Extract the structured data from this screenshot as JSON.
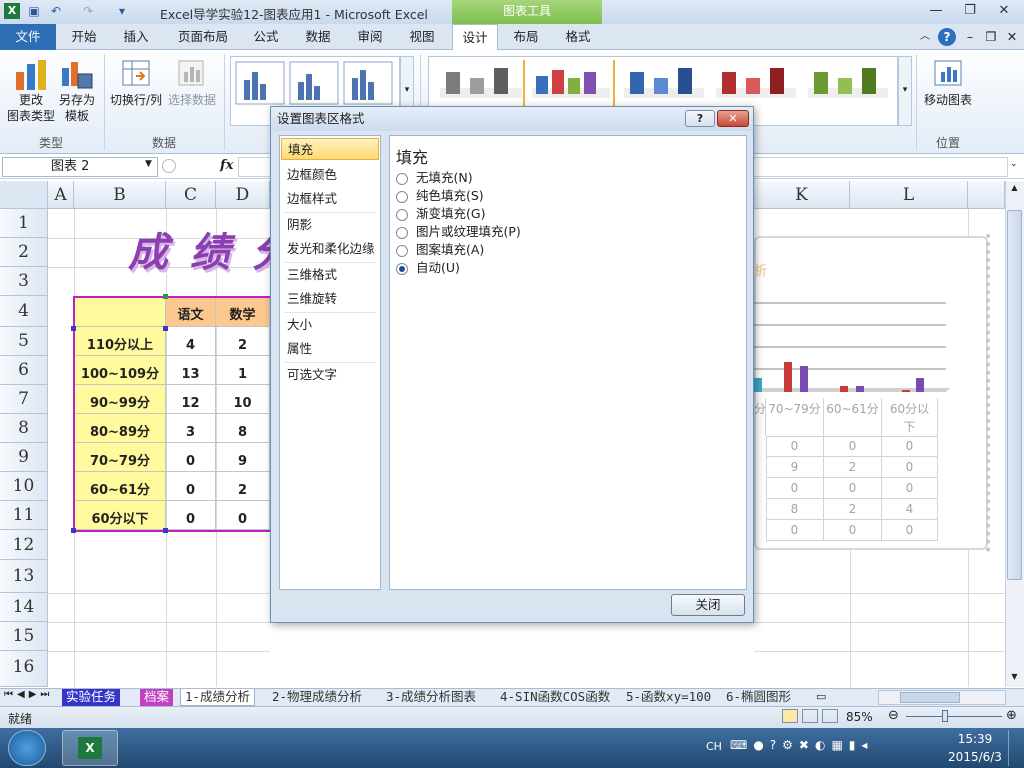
{
  "titlebar": {
    "title": "Excel导学实验12-图表应用1  -  Microsoft Excel",
    "context_tab_group": "图表工具"
  },
  "tabs": [
    "文件",
    "开始",
    "插入",
    "页面布局",
    "公式",
    "数据",
    "审阅",
    "视图",
    "设计",
    "布局",
    "格式"
  ],
  "ribbon": {
    "change_type": "更改\n图表类型",
    "change_type_l1": "更改",
    "change_type_l2": "图表类型",
    "save_template_l1": "另存为",
    "save_template_l2": "模板",
    "group_type": "类型",
    "switch_row_col": "切换行/列",
    "select_data": "选择数据",
    "group_data": "数据",
    "move_chart": "移动图表",
    "group_location": "位置"
  },
  "formula_bar": {
    "name_box": "图表  2",
    "fx": "fx"
  },
  "sheet": {
    "columns": [
      "A",
      "B",
      "C",
      "D",
      "K",
      "L"
    ],
    "rows": [
      "1",
      "2",
      "3",
      "4",
      "5",
      "6",
      "7",
      "8",
      "9",
      "10",
      "11",
      "12",
      "13",
      "14",
      "15",
      "16"
    ],
    "title_art": "成 绩 分",
    "headers": [
      "语文",
      "数学"
    ],
    "labels": [
      "110分以上",
      "100~109分",
      "90~99分",
      "80~89分",
      "70~79分",
      "60~61分",
      "60分以下"
    ],
    "c_values": [
      "4",
      "13",
      "12",
      "3",
      "0",
      "0",
      "0"
    ],
    "d_values": [
      "2",
      "1",
      "10",
      "8",
      "9",
      "2",
      "0"
    ]
  },
  "chart_behind": {
    "categories": [
      "分",
      "70~79分",
      "60~61分",
      "60分以\n下"
    ],
    "cat_labels": [
      "分",
      "70~79分",
      "60~61分",
      "60分以下"
    ],
    "table_rows": [
      [
        "0",
        "0",
        "0"
      ],
      [
        "9",
        "2",
        "0"
      ],
      [
        "0",
        "0",
        "0"
      ],
      [
        "8",
        "2",
        "4"
      ],
      [
        "0",
        "0",
        "0"
      ]
    ]
  },
  "dialog": {
    "title": "设置图表区格式",
    "nav": [
      "填充",
      "边框颜色",
      "边框样式",
      "阴影",
      "发光和柔化边缘",
      "三维格式",
      "三维旋转",
      "大小",
      "属性",
      "可选文字"
    ],
    "selected_nav": "填充",
    "panel_heading": "填充",
    "options": [
      "无填充(N)",
      "纯色填充(S)",
      "渐变填充(G)",
      "图片或纹理填充(P)",
      "图案填充(A)",
      "自动(U)"
    ],
    "selected_option": "自动(U)",
    "close_label": "关闭",
    "help": "?",
    "close_x": "✕"
  },
  "sheet_tabs": [
    "实验任务",
    "档案",
    "1-成绩分析",
    "2-物理成绩分析",
    "3-成绩分析图表",
    "4-SIN函数COS函数",
    "5-函数xy=100",
    "6-椭圆图形"
  ],
  "status": {
    "ready": "就绪",
    "zoom": "85%"
  },
  "taskbar": {
    "lang": "CH",
    "time": "15:39",
    "date": "2015/6/3"
  },
  "colors": {
    "file_tab": "#2e6eb5",
    "context_green": "#7fbf4d",
    "header_fill": "#fbc88f",
    "label_fill": "#fffa9d",
    "table_border": "#c020c0",
    "title_art": "#8b3fb0"
  }
}
